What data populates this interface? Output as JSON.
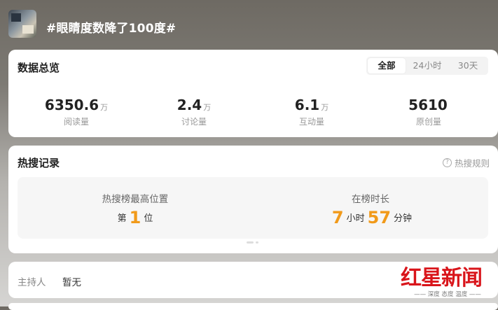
{
  "topic": {
    "title": "#眼睛度数降了100度#"
  },
  "overview": {
    "title": "数据总览",
    "tabs": [
      "全部",
      "24小时",
      "30天"
    ],
    "active_tab": "全部",
    "stats": [
      {
        "value": "6350.6",
        "unit": "万",
        "label": "阅读量"
      },
      {
        "value": "2.4",
        "unit": "万",
        "label": "讨论量"
      },
      {
        "value": "6.1",
        "unit": "万",
        "label": "互动量"
      },
      {
        "value": "5610",
        "unit": "",
        "label": "原创量"
      }
    ]
  },
  "hot_record": {
    "title": "热搜记录",
    "rules_link": "热搜规则",
    "highest_position": {
      "label": "热搜榜最高位置",
      "prefix": "第",
      "value": "1",
      "suffix": "位"
    },
    "duration": {
      "label": "在榜时长",
      "hours": "7",
      "hours_unit": "小时",
      "minutes": "57",
      "minutes_unit": "分钟"
    }
  },
  "host": {
    "label": "主持人",
    "value": "暂无"
  },
  "watermark": {
    "logo": "红星新闻",
    "tagline": "—— 深度 态度 温度 ——"
  },
  "colors": {
    "accent_number": "#f19a1a",
    "watermark_red": "#d9151b"
  }
}
